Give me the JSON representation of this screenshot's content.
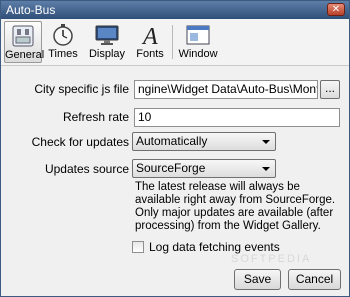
{
  "window": {
    "title": "Auto-Bus",
    "close_glyph": "✕"
  },
  "toolbar": {
    "tabs": [
      {
        "label": "General",
        "icon": "general-settings-icon",
        "active": true
      },
      {
        "label": "Times",
        "icon": "stopwatch-icon",
        "active": false
      },
      {
        "label": "Display",
        "icon": "monitor-icon",
        "active": false
      },
      {
        "label": "Fonts",
        "icon": "font-icon",
        "active": false
      },
      {
        "label": "Window",
        "icon": "window-icon",
        "active": false
      }
    ]
  },
  "form": {
    "city_js_label": "City specific js file",
    "city_js_value": "ngine\\Widget Data\\Auto-Bus\\Montreal.js",
    "browse_label": "...",
    "refresh_label": "Refresh rate",
    "refresh_value": "10",
    "check_updates_label": "Check for updates",
    "check_updates_value": "Automatically",
    "updates_source_label": "Updates source",
    "updates_source_value": "SourceForge",
    "note": "The latest release will always be available right away from SourceForge. Only major updates are available (after processing) from the Widget Gallery.",
    "log_label": "Log data fetching events",
    "log_checked": false
  },
  "buttons": {
    "save": "Save",
    "cancel": "Cancel"
  },
  "watermark": "SOFTPEDIA"
}
